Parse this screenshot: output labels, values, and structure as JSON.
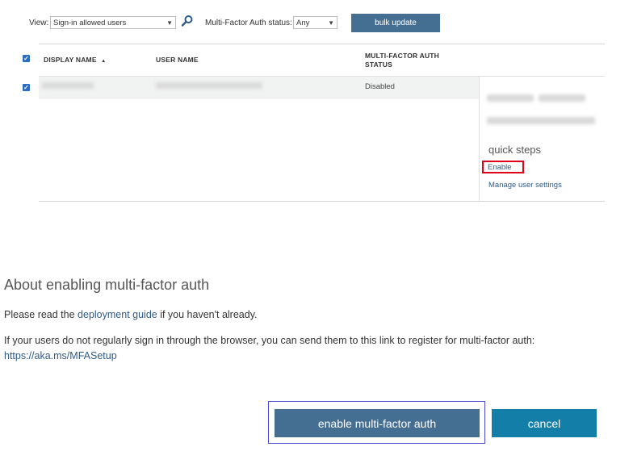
{
  "toolbar": {
    "view_label": "View:",
    "view_value": "Sign-in allowed users",
    "mfa_label": "Multi-Factor Auth status:",
    "mfa_value": "Any",
    "bulk_update_label": "bulk update"
  },
  "table": {
    "columns": {
      "display_name": "DISPLAY NAME",
      "sort_indicator": "▲",
      "user_name": "USER NAME",
      "mfa_status_line1": "MULTI-FACTOR AUTH",
      "mfa_status_line2": "STATUS"
    },
    "rows": [
      {
        "mfa_status": "Disabled",
        "selected": true
      }
    ]
  },
  "side_panel": {
    "quick_steps_title": "quick steps",
    "enable_link": "Enable",
    "manage_link": "Manage user settings"
  },
  "about": {
    "title": "About enabling multi-factor auth",
    "para1_pre": "Please read the ",
    "para1_link": "deployment guide",
    "para1_post": " if you haven't already.",
    "para2_text": "If your users do not regularly sign in through the browser, you can send them to this link to register for multi-factor auth: ",
    "para2_link": "https://aka.ms/MFASetup"
  },
  "buttons": {
    "enable_mfa": "enable multi-factor auth",
    "cancel": "cancel"
  },
  "icons": {
    "checkbox": "check-icon",
    "search": "search-icon",
    "dropdown": "chevron-down-icon"
  },
  "colors": {
    "primary_button": "#456f92",
    "cancel_button": "#137fa8",
    "link": "#2f5b8a",
    "highlight_red": "#e1001a",
    "highlight_blue": "#4b4ad2",
    "checkbox": "#2b6cc4"
  }
}
